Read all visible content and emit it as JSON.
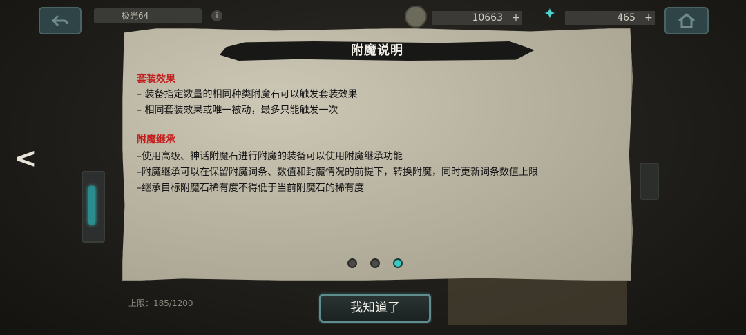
{
  "header": {
    "player_name": "极光64",
    "info_symbol": "i",
    "coins": "10663",
    "gems": "465",
    "plus_symbol": "+"
  },
  "nav": {
    "prev_symbol": "<"
  },
  "background": {
    "limit_text": "上限：185/1200"
  },
  "dialog": {
    "title": "附魔说明",
    "sections": [
      {
        "heading": "套装效果",
        "lines": [
          "– 装备指定数量的相同种类附魔石可以触发套装效果",
          "– 相同套装效果或唯一被动，最多只能触发一次"
        ]
      },
      {
        "heading": "附魔继承",
        "lines": [
          "–使用高级、神话附魔石进行附魔的装备可以使用附魔继承功能",
          "–附魔继承可以在保留附魔词条、数值和封魔情况的前提下，转换附魔，同时更新词条数值上限",
          "–继承目标附魔石稀有度不得低于当前附魔石的稀有度"
        ]
      }
    ],
    "page_total": 3,
    "page_current": 3,
    "confirm_label": "我知道了"
  },
  "colors": {
    "section_heading": "#c41f1f",
    "dot_active": "#39c9c0",
    "dot_inactive": "#4a4a48"
  }
}
